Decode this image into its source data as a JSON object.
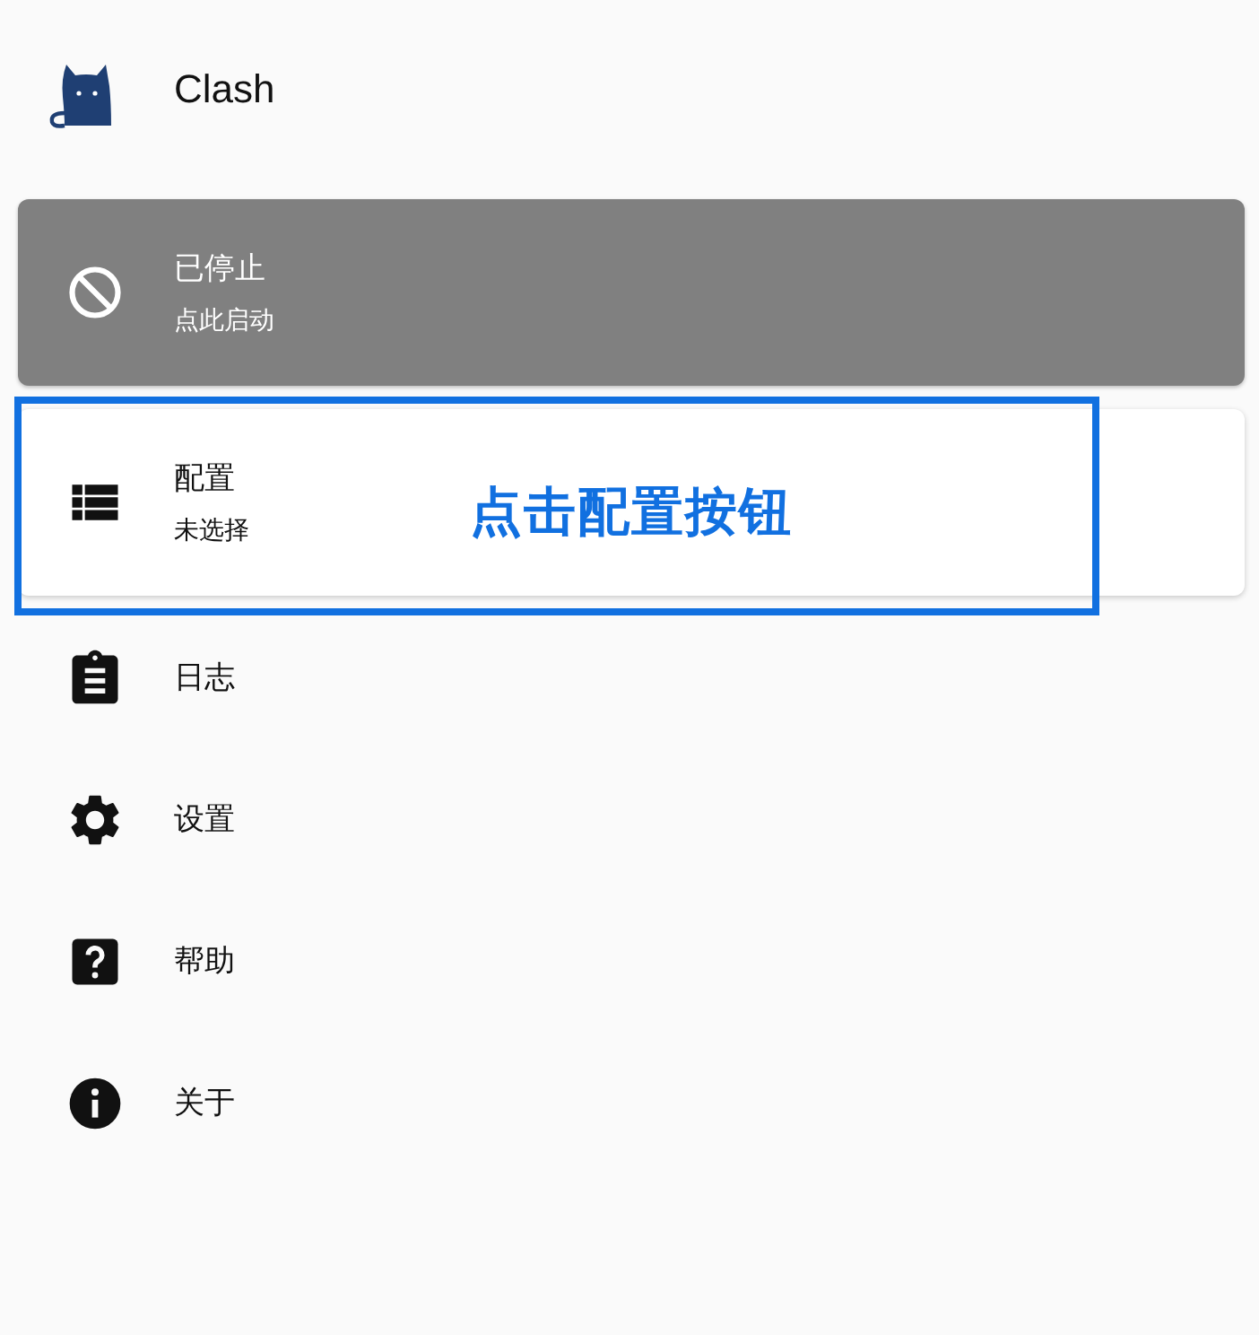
{
  "app": {
    "title": "Clash"
  },
  "cards": [
    {
      "kind": "status",
      "title": "已停止",
      "subtitle": "点此启动"
    },
    {
      "kind": "profile",
      "title": "配置",
      "subtitle": "未选择"
    }
  ],
  "menu": [
    {
      "kind": "logs",
      "label": "日志"
    },
    {
      "kind": "settings",
      "label": "设置"
    },
    {
      "kind": "help",
      "label": "帮助"
    },
    {
      "kind": "about",
      "label": "关于"
    }
  ],
  "annotation": {
    "text": "点击配置按钮"
  }
}
